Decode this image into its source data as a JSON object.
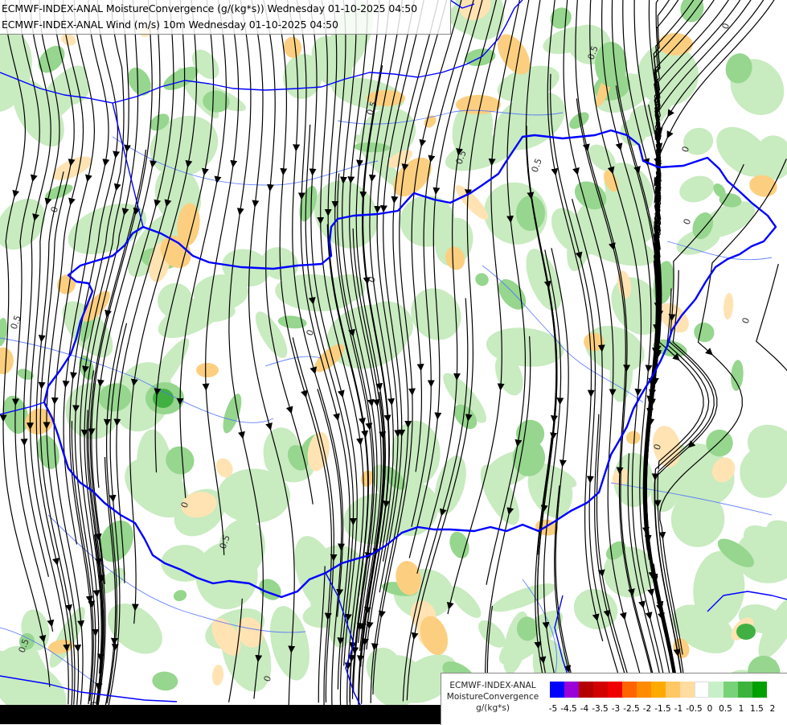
{
  "titles": {
    "line1": "ECMWF-INDEX-ANAL MoistureConvergence (g/(kg*s)) Wednesday 01-10-2025 04:50",
    "line2": "ECMWF-INDEX-ANAL Wind (m/s) 10m Wednesday 01-10-2025 04:50"
  },
  "legend": {
    "name_line1": "ECMWF-INDEX-ANAL",
    "name_line2": "MoistureConvergence",
    "unit": "g/(kg*s)",
    "tick_labels": [
      "-5",
      "-4.5",
      "-4",
      "-3.5",
      "-3",
      "-2.5",
      "-2",
      "-1.5",
      "-1",
      "-0.5",
      "0",
      "0.5",
      "1",
      "1.5",
      "2"
    ],
    "colors": [
      "#0000ff",
      "#9a00d8",
      "#b40000",
      "#d20000",
      "#f00000",
      "#ff6400",
      "#ff8c00",
      "#ffaa00",
      "#ffc864",
      "#ffdca0",
      "#ffffff",
      "#c8f0c8",
      "#78d278",
      "#3cb43c",
      "#00a000"
    ]
  },
  "contour_labels": [
    "0",
    "0.5"
  ],
  "colors": {
    "border": "#0000ff",
    "river": "#4a6cff",
    "stream": "#000000",
    "green_light": "#c8ebc0",
    "green_mid": "#96d68e",
    "green_dark": "#41b043",
    "orange_light": "#ffe3b3",
    "orange_mid": "#fccf80"
  }
}
